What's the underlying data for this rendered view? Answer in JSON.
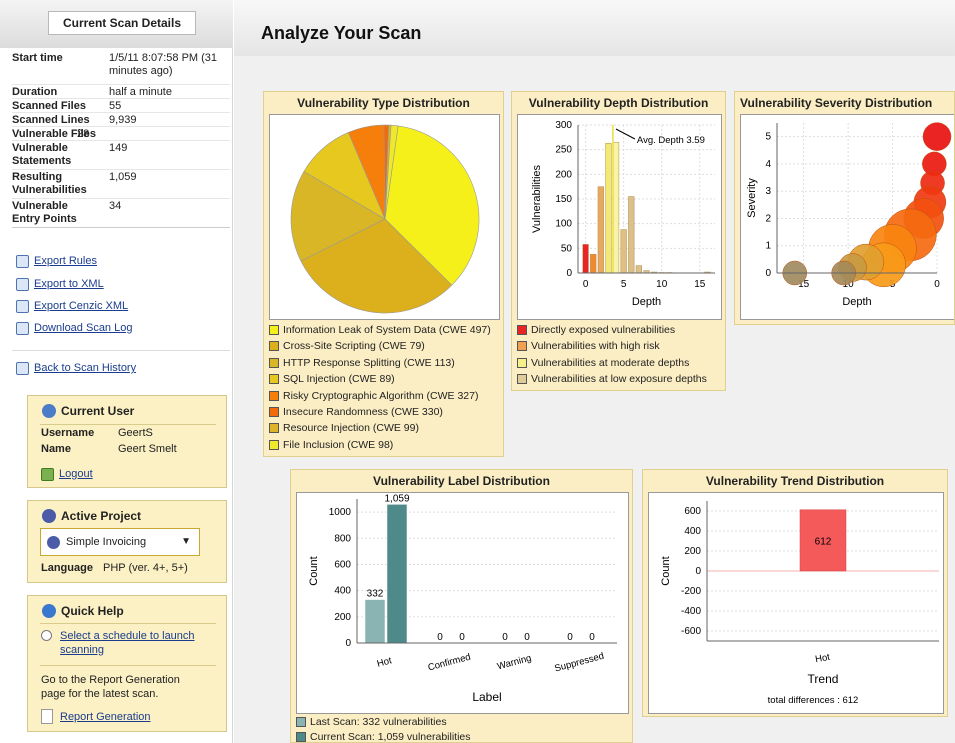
{
  "sidebar": {
    "title": "Current Scan Details",
    "details": [
      {
        "key": "Start time",
        "value": "1/5/11 8:07:58 PM (31 minutes ago)"
      },
      {
        "key": "Duration",
        "value": "half a minute"
      },
      {
        "key": "Scanned Files",
        "value": "55"
      },
      {
        "key": "Scanned Lines",
        "value": "9,939"
      },
      {
        "key": "Vulnerable Files",
        "value": "28"
      },
      {
        "key": "Vulnerable Statements",
        "value": "149"
      },
      {
        "key": "Resulting Vulnerabilities",
        "value": "1,059"
      },
      {
        "key": "Vulnerable Entry Points",
        "value": "34"
      }
    ],
    "links": {
      "export_rules": "Export Rules",
      "export_xml": "Export to XML",
      "export_cenzic": "Export Cenzic XML",
      "download_log": "Download Scan Log",
      "back_history": "Back to Scan History"
    },
    "current_user": {
      "title": "Current User",
      "username_label": "Username",
      "username": "GeertS",
      "name_label": "Name",
      "name": "Geert Smelt",
      "logout": "Logout"
    },
    "active_project": {
      "title": "Active Project",
      "selected": "Simple Invoicing",
      "language_label": "Language",
      "language": "PHP (ver. 4+, 5+)"
    },
    "quick_help": {
      "title": "Quick Help",
      "link": "Select a schedule to launch scanning",
      "text": "Go to the Report Generation page for the latest scan.",
      "report_link": "Report Generation"
    }
  },
  "main": {
    "title": "Analyze Your Scan"
  },
  "colors": {
    "yellow": "#f5f01a",
    "gold": "#d4b020",
    "orange": "#f57f0a",
    "red": "#e82020",
    "teal_light": "#8ab3b3",
    "teal_dark": "#4f8a8a",
    "trend_red": "#f45a5a"
  },
  "chart_data": [
    {
      "type": "pie",
      "title": "Vulnerability Type Distribution",
      "series": [
        {
          "name": "Information Leak of System Data (CWE 497)",
          "value": 35.2,
          "color": "#f5f01a"
        },
        {
          "name": "Cross-Site Scripting (CWE 79)",
          "value": 30.2,
          "color": "#dcb01c"
        },
        {
          "name": "HTTP Response Splitting (CWE 113)",
          "value": 15.8,
          "color": "#d9b626"
        },
        {
          "name": "SQL Injection (CWE 89)",
          "value": 10.2,
          "color": "#e6c81f"
        },
        {
          "name": "Risky Cryptographic Algorithm (CWE 327)",
          "value": 6.2,
          "color": "#f57f0a"
        },
        {
          "name": "Insecure Randomness (CWE 330)",
          "value": 0.8,
          "color": "#f26a0a"
        },
        {
          "name": "Resource Injection (CWE 99)",
          "value": 0.4,
          "color": "#ddb32a"
        },
        {
          "name": "File Inclusion (CWE 98)",
          "value": 1.2,
          "color": "#f0e82a"
        }
      ]
    },
    {
      "type": "bar",
      "title": "Vulnerability Depth Distribution",
      "xlabel": "Depth",
      "ylabel": "Vulnerabilities",
      "ylim": [
        0,
        300
      ],
      "xlim": [
        -1,
        17
      ],
      "x_ticks": [
        0,
        5,
        10,
        15
      ],
      "y_ticks": [
        0,
        50,
        100,
        150,
        200,
        250,
        300
      ],
      "annotation": "Avg. Depth 3.59",
      "avg_depth": 3.59,
      "x": [
        0,
        1,
        2,
        3,
        4,
        5,
        6,
        7,
        8,
        9,
        10,
        11,
        16
      ],
      "values": [
        58,
        38,
        175,
        263,
        265,
        88,
        155,
        15,
        5,
        2,
        1,
        1,
        2
      ],
      "colors": [
        "#e82424",
        "#f08a30",
        "#e8a860",
        "#f5e870",
        "#f8f3a6",
        "#e0c080",
        "#dcc08c",
        "#dcc08c",
        "#d6c09a",
        "#d6c09a",
        "#d6c09a",
        "#d6c09a",
        "#d6c09a"
      ],
      "legend": [
        {
          "label": "Directly exposed vulnerabilities",
          "color": "#e82424"
        },
        {
          "label": "Vulnerabilities with high risk",
          "color": "#f0a050"
        },
        {
          "label": "Vulnerabilities at moderate depths",
          "color": "#f5f08a"
        },
        {
          "label": "Vulnerabilities at low exposure depths",
          "color": "#e0cc9a"
        }
      ]
    },
    {
      "type": "scatter",
      "title": "Vulnerability Severity Distribution",
      "xlabel": "Depth",
      "ylabel": "Severity",
      "xlim": [
        18,
        0
      ],
      "ylim": [
        0,
        5.5
      ],
      "x_ticks": [
        15,
        10,
        5,
        0
      ],
      "y_ticks": [
        0,
        1,
        2,
        3,
        4,
        5
      ],
      "points": [
        {
          "x": 0,
          "y": 5,
          "r": 14,
          "color": "#e81010"
        },
        {
          "x": 0.3,
          "y": 4,
          "r": 12,
          "color": "#ea1a10"
        },
        {
          "x": 0.5,
          "y": 3.3,
          "r": 12,
          "color": "#ee2a10"
        },
        {
          "x": 0.8,
          "y": 2.6,
          "r": 16,
          "color": "#f03a10"
        },
        {
          "x": 1.5,
          "y": 2,
          "r": 20,
          "color": "#f25010"
        },
        {
          "x": 3,
          "y": 1.4,
          "r": 26,
          "color": "#f56a10"
        },
        {
          "x": 5,
          "y": 0.9,
          "r": 24,
          "color": "#f88410"
        },
        {
          "x": 6,
          "y": 0.3,
          "r": 22,
          "color": "#f89a18"
        },
        {
          "x": 8,
          "y": 0.4,
          "r": 18,
          "color": "#e0a030"
        },
        {
          "x": 9.5,
          "y": 0.2,
          "r": 14,
          "color": "#c89a40"
        },
        {
          "x": 10.5,
          "y": 0,
          "r": 12,
          "color": "#a48a58"
        },
        {
          "x": 16,
          "y": 0,
          "r": 12,
          "color": "#a08a60"
        }
      ]
    },
    {
      "type": "bar",
      "title": "Vulnerability Label Distribution",
      "xlabel": "Label",
      "ylabel": "Count",
      "ylim": [
        0,
        1100
      ],
      "y_ticks": [
        0,
        200,
        400,
        600,
        800,
        1000
      ],
      "categories": [
        "Hot",
        "Confirmed",
        "Warning",
        "Suppressed"
      ],
      "series": [
        {
          "name": "Last Scan: 332 vulnerabilities",
          "values": [
            332,
            0,
            0,
            0
          ],
          "labels": [
            "332",
            "0",
            "0",
            "0"
          ],
          "color": "#8ab3b3"
        },
        {
          "name": "Current Scan: 1,059 vulnerabilities",
          "values": [
            1059,
            0,
            0,
            0
          ],
          "labels": [
            "1,059",
            "0",
            "0",
            "0"
          ],
          "color": "#4f8a8a"
        }
      ]
    },
    {
      "type": "bar",
      "title": "Vulnerability Trend Distribution",
      "xlabel": "Trend",
      "ylabel": "Count",
      "ylim": [
        -700,
        700
      ],
      "y_ticks": [
        600,
        400,
        200,
        0,
        -200,
        -400,
        -600
      ],
      "categories": [
        "Hot"
      ],
      "values": [
        612
      ],
      "labels": [
        "612"
      ],
      "footer": "total differences : 612"
    }
  ]
}
